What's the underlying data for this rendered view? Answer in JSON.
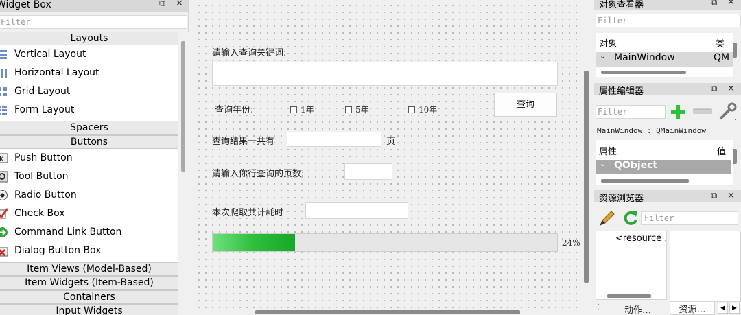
{
  "widget_box": {
    "title": "Widget Box",
    "float_icon": "⧉",
    "close_icon": "✕",
    "filter_placeholder": "Filter",
    "categories": {
      "layouts": "Layouts",
      "spacers": "Spacers",
      "buttons": "Buttons",
      "item_views": "Item Views (Model-Based)",
      "item_widgets": "Item Widgets (Item-Based)",
      "containers": "Containers",
      "input_widgets": "Input Widgets"
    },
    "layouts": [
      "Vertical Layout",
      "Horizontal Layout",
      "Grid Layout",
      "Form Layout"
    ],
    "buttons": [
      "Push Button",
      "Tool Button",
      "Radio Button",
      "Check Box",
      "Command Link Button",
      "Dialog Button Box"
    ]
  },
  "form": {
    "keyword_label": "请输入查询关键词:",
    "keyword_value": "",
    "year_label": "查询年份:",
    "checkboxes": [
      {
        "label": "1年",
        "checked": false
      },
      {
        "label": "5年",
        "checked": false
      },
      {
        "label": "10年",
        "checked": false
      }
    ],
    "query_button": "查询",
    "result_label": "查询结果一共有",
    "result_value": "",
    "page_unit": "页",
    "pages_label": "请输入你行查询的页数:",
    "pages_value": "",
    "time_label": "本次爬取共计耗时",
    "time_value": "",
    "progress_percent": 24,
    "progress_text": "24%"
  },
  "object_inspector": {
    "title": "对象查看器",
    "filter_placeholder": "Filter",
    "col_object": "对象",
    "col_class": "类",
    "row_object": "MainWindow",
    "row_class": "QM",
    "expander": "⌄"
  },
  "property_editor": {
    "title": "属性编辑器",
    "filter_placeholder": "Filter",
    "context": "MainWindow : QMainWindow",
    "col_property": "属性",
    "col_value": "值",
    "group_row": "QObject",
    "expander": "⌄"
  },
  "resource_browser": {
    "title": "资源浏览器",
    "filter_placeholder": "Filter",
    "resource_item": "<resource .",
    "tabs": [
      "动作…",
      "资源…"
    ],
    "dots": "⁚",
    "prev": "◀",
    "next": "▶"
  },
  "colors": {
    "progress_fill": "#16a829",
    "header_bar": "#dcdcdc",
    "selection_gray": "#a8a8a8"
  }
}
